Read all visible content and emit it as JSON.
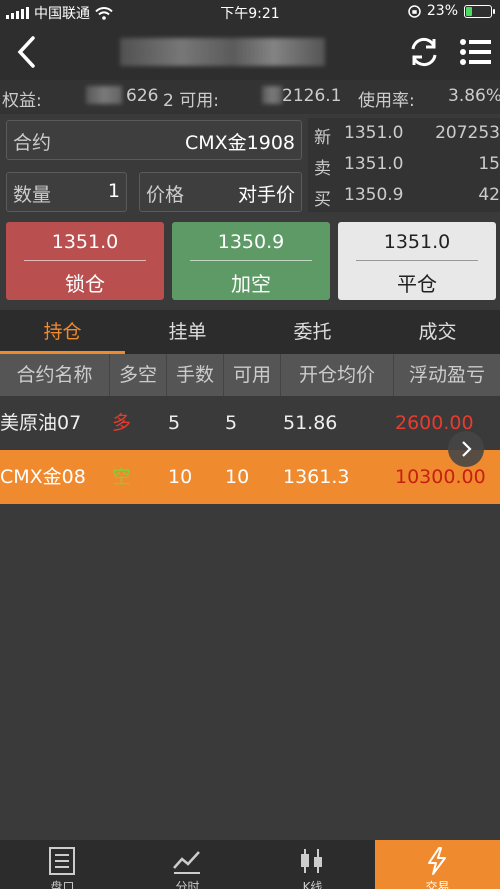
{
  "status_bar": {
    "carrier": "中国联通",
    "time": "下午9:21",
    "battery": "23%"
  },
  "account": {
    "equity_label": "权益:",
    "equity_value": "626",
    "available_label": "2 可用:",
    "available_value": "2126.1",
    "usage_label": "使用率:",
    "usage_value": "3.86%"
  },
  "order_form": {
    "contract_label": "合约",
    "contract_value": "CMX金1908",
    "qty_label": "数量",
    "qty_value": "1",
    "price_label": "价格",
    "price_value": "对手价"
  },
  "quote": [
    {
      "label": "新",
      "price": "1351.0",
      "volume": "207253"
    },
    {
      "label": "卖",
      "price": "1351.0",
      "volume": "15"
    },
    {
      "label": "买",
      "price": "1350.9",
      "volume": "42"
    }
  ],
  "actions": [
    {
      "price": "1351.0",
      "label": "锁仓"
    },
    {
      "price": "1350.9",
      "label": "加空"
    },
    {
      "price": "1351.0",
      "label": "平仓"
    }
  ],
  "tabs": [
    "持仓",
    "挂单",
    "委托",
    "成交"
  ],
  "table": {
    "headers": [
      "合约名称",
      "多空",
      "手数",
      "可用",
      "开仓均价",
      "浮动盈亏"
    ],
    "rows": [
      {
        "name": "美原油07",
        "side": "多",
        "qty": "5",
        "avail": "5",
        "avg": "51.86",
        "pnl": "2600.00"
      },
      {
        "name": "CMX金08",
        "side": "空",
        "qty": "10",
        "avail": "10",
        "avg": "1361.3",
        "pnl": "10300.00"
      }
    ]
  },
  "bottom_nav": [
    "盘口",
    "分时",
    "K线",
    "交易"
  ],
  "colors": {
    "accent": "#f08a2e",
    "long": "#e83b2e",
    "short": "#7fd13a",
    "lock": "#b94f4f",
    "add_short": "#5e9a66",
    "close": "#e8e8e8"
  }
}
